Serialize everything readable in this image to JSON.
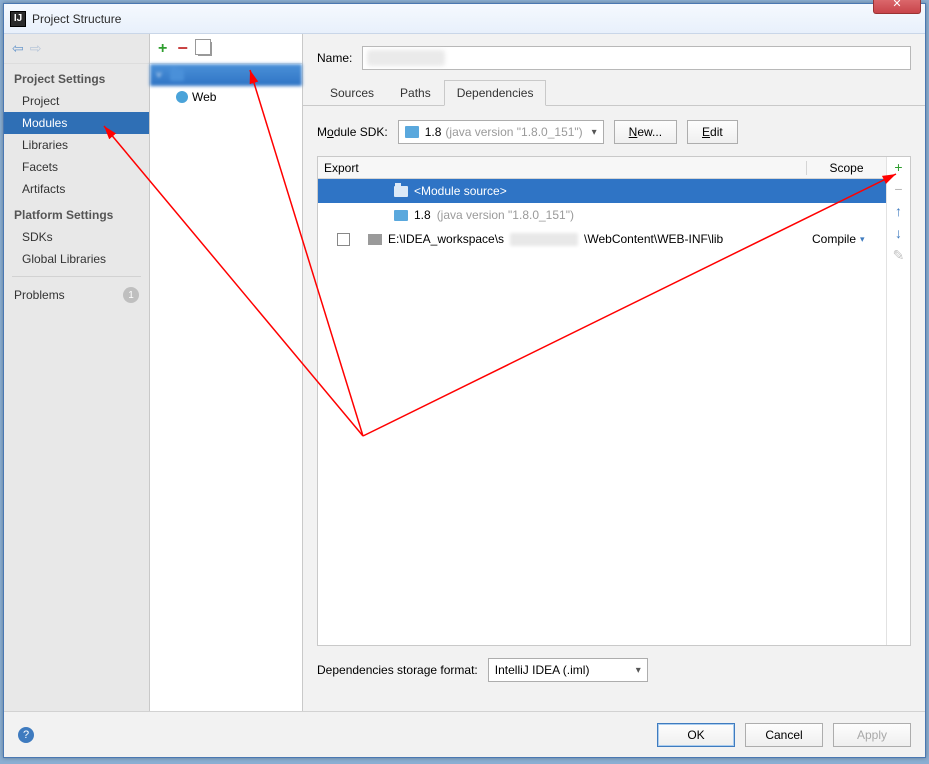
{
  "window": {
    "title": "Project Structure",
    "app_glyph": "IJ"
  },
  "titlebar_buttons": {
    "close_glyph": "✕"
  },
  "sidebar": {
    "sections": {
      "project_settings_header": "Project Settings",
      "platform_settings_header": "Platform Settings"
    },
    "items": {
      "project": "Project",
      "modules": "Modules",
      "libraries": "Libraries",
      "facets": "Facets",
      "artifacts": "Artifacts",
      "sdks": "SDKs",
      "global_libraries": "Global Libraries",
      "problems": "Problems"
    },
    "problems_count": "1"
  },
  "tree": {
    "module_name": "",
    "web_label": "Web"
  },
  "main": {
    "name_label": "Name:",
    "name_value": "",
    "tabs": {
      "sources": "Sources",
      "paths": "Paths",
      "dependencies": "Dependencies"
    },
    "sdk_label_pre": "M",
    "sdk_label_u": "o",
    "sdk_label_post": "dule SDK:",
    "sdk_combo": {
      "version": "1.8",
      "detail": "(java version \"1.8.0_151\")"
    },
    "new_btn_u": "N",
    "new_btn_post": "ew...",
    "edit_btn_u": "E",
    "edit_btn_post": "dit",
    "dep_head": {
      "export": "Export",
      "scope": "Scope"
    },
    "dep_rows": [
      {
        "name": "<Module source>"
      },
      {
        "name_pre": "1.8 ",
        "name_gray": "(java version \"1.8.0_151\")"
      },
      {
        "path_pre": "E:\\IDEA_workspace\\s",
        "path_post": "\\WebContent\\WEB-INF\\lib",
        "scope": "Compile"
      }
    ],
    "storage_label": "Dependencies storage format:",
    "storage_value": "IntelliJ IDEA (.iml)"
  },
  "footer": {
    "ok": "OK",
    "cancel": "Cancel",
    "apply": "Apply",
    "help_glyph": "?"
  },
  "icons": {
    "plus": "+",
    "minus": "−",
    "chev_down": "▾",
    "chev_down_small": "˅",
    "arrow_left": "⇦",
    "arrow_right": "⇨",
    "arrow_up": "↑",
    "arrow_down": "↓",
    "pencil": "✎"
  }
}
